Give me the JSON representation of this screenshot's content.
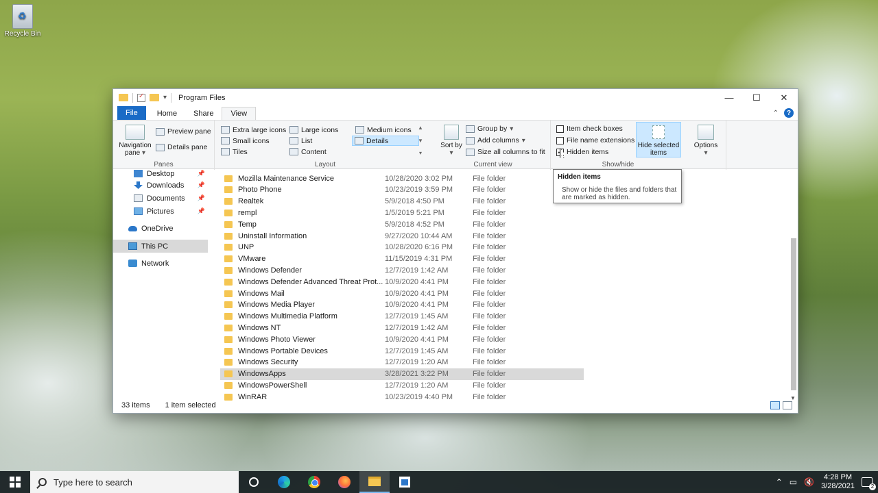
{
  "desktop": {
    "recycle_bin": "Recycle Bin"
  },
  "window": {
    "title": "Program Files",
    "controls": {
      "minimize": "—",
      "maximize": "☐",
      "close": "✕"
    }
  },
  "tabs": [
    "File",
    "Home",
    "Share",
    "View"
  ],
  "ribbon": {
    "panes": {
      "label": "Panes",
      "navigation_pane": "Navigation pane",
      "preview_pane": "Preview pane",
      "details_pane": "Details pane"
    },
    "layout": {
      "label": "Layout",
      "items": [
        "Extra large icons",
        "Large icons",
        "Medium icons",
        "Small icons",
        "List",
        "Details",
        "Tiles",
        "Content"
      ],
      "selected": "Details"
    },
    "current_view": {
      "label": "Current view",
      "sort_by": "Sort by",
      "group_by": "Group by",
      "add_columns": "Add columns",
      "size_all": "Size all columns to fit"
    },
    "show_hide": {
      "label": "Show/hide",
      "item_check_boxes": {
        "text": "Item check boxes",
        "checked": false
      },
      "file_name_extensions": {
        "text": "File name extensions",
        "checked": false
      },
      "hidden_items": {
        "text": "Hidden items",
        "checked": true
      },
      "hide_selected": "Hide selected items"
    },
    "options": "Options"
  },
  "nav": {
    "items": [
      {
        "label": "Desktop",
        "pinned": true
      },
      {
        "label": "Downloads",
        "pinned": true
      },
      {
        "label": "Documents",
        "pinned": true
      },
      {
        "label": "Pictures",
        "pinned": true
      },
      {
        "label": "OneDrive",
        "pinned": false
      },
      {
        "label": "This PC",
        "pinned": false,
        "selected": true
      },
      {
        "label": "Network",
        "pinned": false
      }
    ]
  },
  "files": [
    {
      "name": "Mozilla Maintenance Service",
      "date": "10/28/2020 3:02 PM",
      "type": "File folder"
    },
    {
      "name": "Photo Phone",
      "date": "10/23/2019 3:59 PM",
      "type": "File folder"
    },
    {
      "name": "Realtek",
      "date": "5/9/2018 4:50 PM",
      "type": "File folder"
    },
    {
      "name": "rempl",
      "date": "1/5/2019 5:21 PM",
      "type": "File folder"
    },
    {
      "name": "Temp",
      "date": "5/9/2018 4:52 PM",
      "type": "File folder"
    },
    {
      "name": "Uninstall Information",
      "date": "9/27/2020 10:44 AM",
      "type": "File folder"
    },
    {
      "name": "UNP",
      "date": "10/28/2020 6:16 PM",
      "type": "File folder"
    },
    {
      "name": "VMware",
      "date": "11/15/2019 4:31 PM",
      "type": "File folder"
    },
    {
      "name": "Windows Defender",
      "date": "12/7/2019 1:42 AM",
      "type": "File folder"
    },
    {
      "name": "Windows Defender Advanced Threat Prot...",
      "date": "10/9/2020 4:41 PM",
      "type": "File folder"
    },
    {
      "name": "Windows Mail",
      "date": "10/9/2020 4:41 PM",
      "type": "File folder"
    },
    {
      "name": "Windows Media Player",
      "date": "10/9/2020 4:41 PM",
      "type": "File folder"
    },
    {
      "name": "Windows Multimedia Platform",
      "date": "12/7/2019 1:45 AM",
      "type": "File folder"
    },
    {
      "name": "Windows NT",
      "date": "12/7/2019 1:42 AM",
      "type": "File folder"
    },
    {
      "name": "Windows Photo Viewer",
      "date": "10/9/2020 4:41 PM",
      "type": "File folder"
    },
    {
      "name": "Windows Portable Devices",
      "date": "12/7/2019 1:45 AM",
      "type": "File folder"
    },
    {
      "name": "Windows Security",
      "date": "12/7/2019 1:20 AM",
      "type": "File folder"
    },
    {
      "name": "WindowsApps",
      "date": "3/28/2021 3:22 PM",
      "type": "File folder",
      "selected": true
    },
    {
      "name": "WindowsPowerShell",
      "date": "12/7/2019 1:20 AM",
      "type": "File folder"
    },
    {
      "name": "WinRAR",
      "date": "10/23/2019 4:40 PM",
      "type": "File folder"
    }
  ],
  "status": {
    "items": "33 items",
    "selected": "1 item selected"
  },
  "tooltip": {
    "title": "Hidden items",
    "body": "Show or hide the files and folders that are marked as hidden."
  },
  "taskbar": {
    "search_placeholder": "Type here to search",
    "time": "4:28 PM",
    "date": "3/28/2021",
    "notification_count": "2",
    "icons": [
      "start-icon",
      "cortana-icon",
      "edge-icon",
      "chrome-icon",
      "firefox-icon",
      "file-explorer-icon",
      "store-icon"
    ]
  }
}
